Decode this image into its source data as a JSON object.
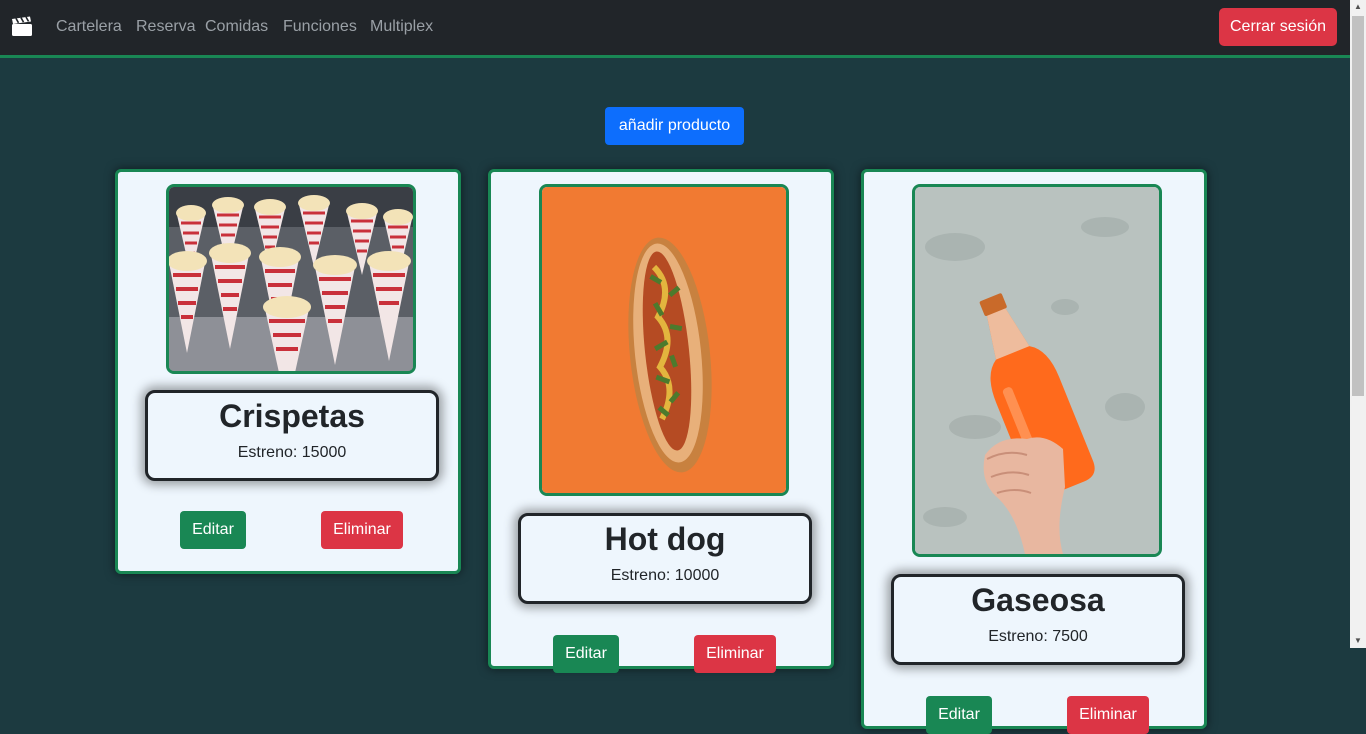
{
  "nav": {
    "brand_icon": "clapperboard-icon",
    "links": [
      "Cartelera",
      "Reserva",
      "Comidas",
      "Funciones",
      "Multiplex"
    ],
    "logout_label": "Cerrar sesión"
  },
  "main": {
    "add_label": "añadir producto"
  },
  "products": [
    {
      "name": "Crispetas",
      "price": "Estreno: 15000",
      "image": "popcorn-cones",
      "edit_label": "Editar",
      "delete_label": "Eliminar"
    },
    {
      "name": "Hot dog",
      "price": "Estreno: 10000",
      "image": "hot-dog",
      "edit_label": "Editar",
      "delete_label": "Eliminar"
    },
    {
      "name": "Gaseosa",
      "price": "Estreno: 7500",
      "image": "soda-bottle",
      "edit_label": "Editar",
      "delete_label": "Eliminar"
    }
  ],
  "colors": {
    "background": "#1c3a40",
    "navbar": "#212529",
    "accent_green": "#198754",
    "danger": "#dc3545",
    "primary": "#0d6efd",
    "card": "#eef6fd"
  }
}
